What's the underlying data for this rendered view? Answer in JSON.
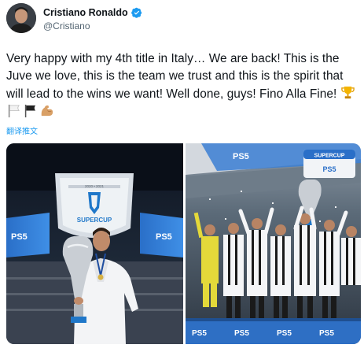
{
  "author": {
    "name": "Cristiano Ronaldo",
    "handle": "@Cristiano",
    "verified": true,
    "avatar_icon": "profile-avatar"
  },
  "tweet": {
    "text": "Very happy with my 4th title in Italy… We are back! This is the Juve we love, this is the team we trust and this is the spirit that will lead to the wins we want! Well done, guys! Fino Alla Fine!",
    "emojis": [
      "trophy-icon",
      "white-flag-icon",
      "black-flag-icon",
      "flexed-biceps-icon"
    ],
    "translate_label": "翻译推文"
  },
  "media": {
    "left": {
      "board_year": "2020 • 2021",
      "board_label": "SUPERCUP",
      "sponsor": "PS5"
    },
    "right": {
      "board_label": "SUPERCUP",
      "sponsor": "PS5"
    }
  },
  "colors": {
    "verified_blue": "#1d9bf0",
    "link_blue": "#1d9bf0",
    "handle_gray": "#536471"
  }
}
